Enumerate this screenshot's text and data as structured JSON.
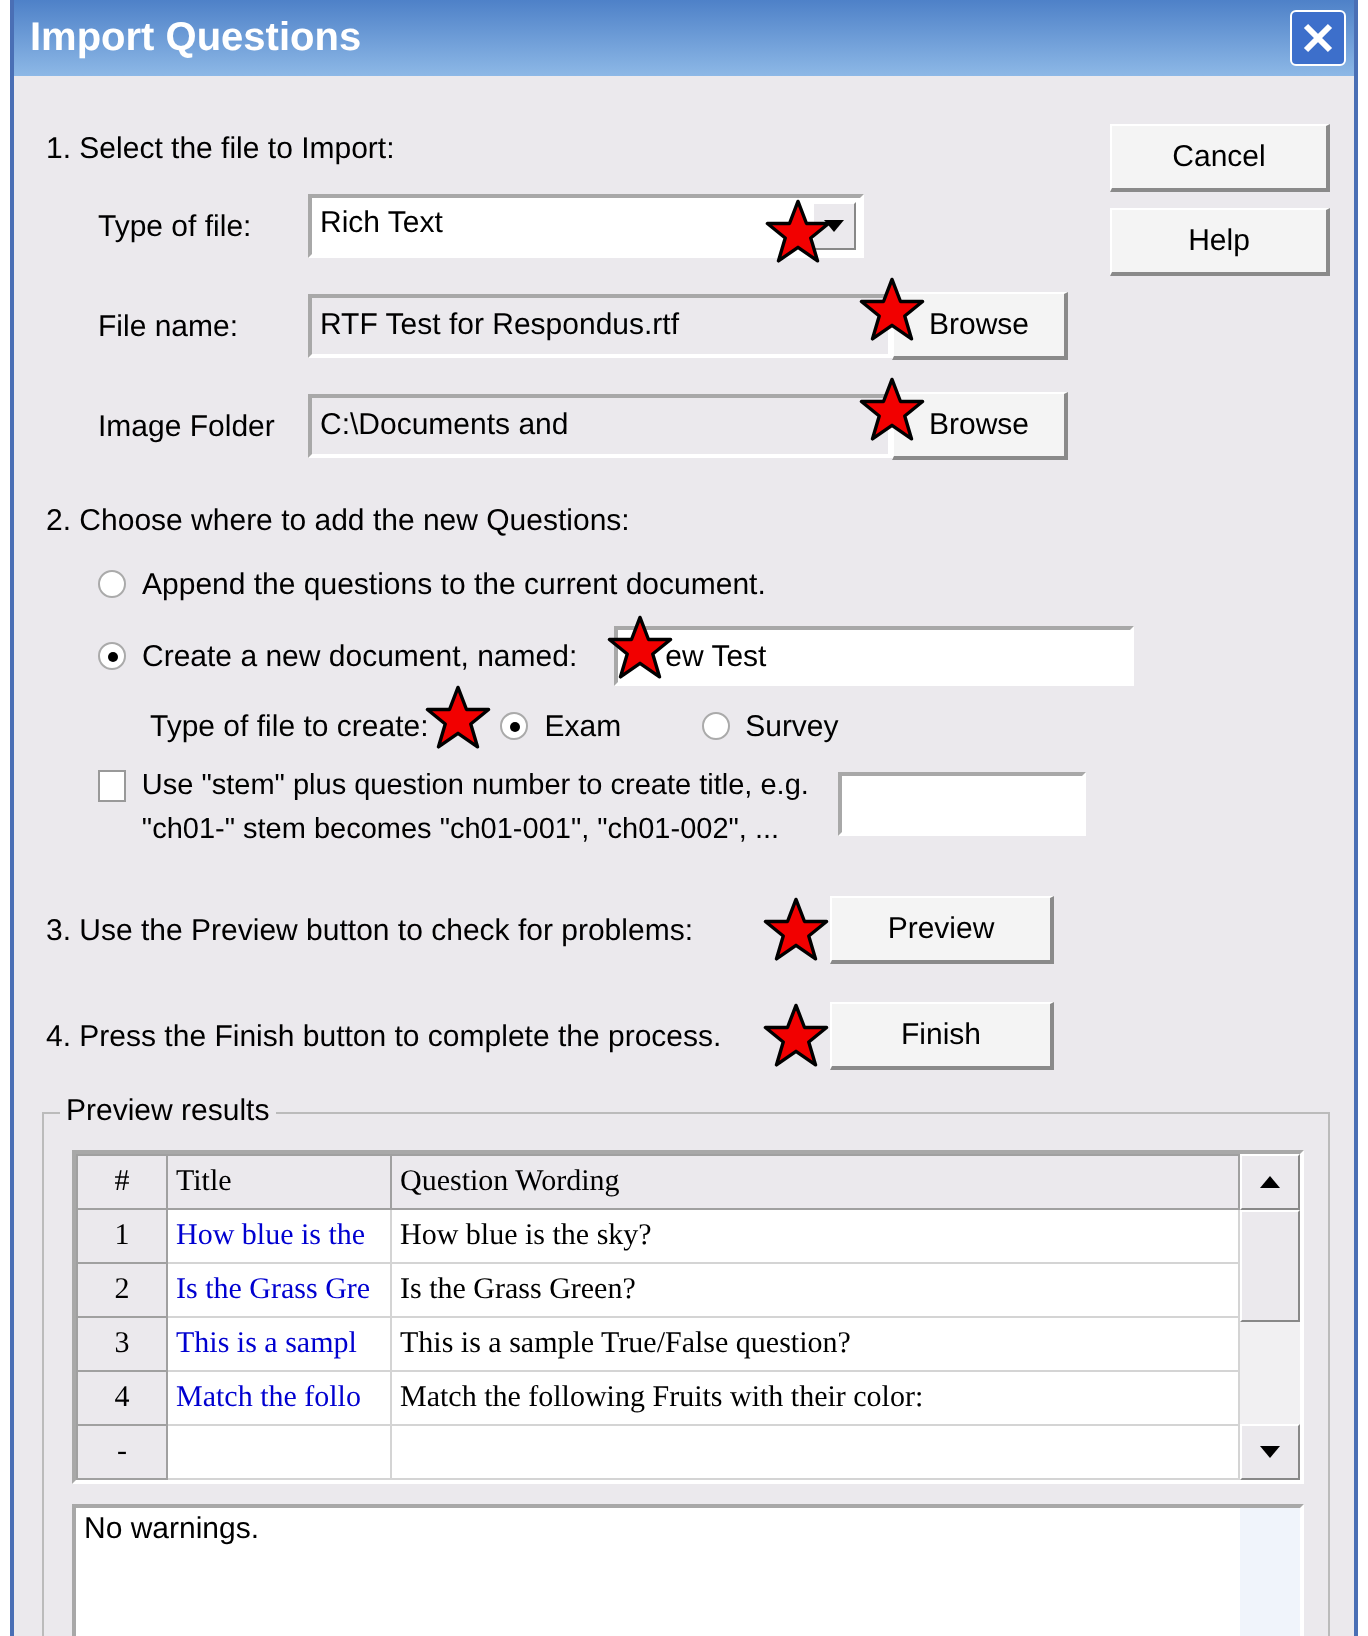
{
  "window": {
    "title": "Import Questions"
  },
  "side_buttons": [
    "Cancel",
    "Help"
  ],
  "step1": {
    "heading": "1.  Select the file to Import:",
    "type_of_file": {
      "label": "Type of file:",
      "value": "Rich Text"
    },
    "file_name": {
      "label": "File name:",
      "value": "RTF Test for Respondus.rtf",
      "button": "Browse"
    },
    "image_folder": {
      "label": "Image Folder",
      "value": "C:\\Documents and",
      "button": "Browse"
    }
  },
  "step2": {
    "heading": "2.  Choose where to add the new Questions:",
    "destinations": [
      {
        "label": "Append the questions to the current document.",
        "selected": false
      },
      {
        "label": "Create a new document, named:",
        "selected": true
      }
    ],
    "document_name": "ew Test",
    "type_label": "Type of file to create:",
    "types": [
      {
        "label": "Exam",
        "selected": true
      },
      {
        "label": "Survey",
        "selected": false
      }
    ],
    "stem": {
      "label_line1": "Use \"stem\" plus question number to create title,  e.g.",
      "label_line2": "\"ch01-\" stem becomes \"ch01-001\",  \"ch01-002\",  ...",
      "checked": false
    }
  },
  "step3": {
    "text": "3.  Use the Preview button to check for problems:",
    "button": "Preview"
  },
  "step4": {
    "text": "4.  Press the Finish button to complete the process.",
    "button": "Finish"
  },
  "preview": {
    "legend": "Preview results",
    "columns": [
      "#",
      "Title",
      "Question Wording"
    ],
    "rows": [
      {
        "num": "1",
        "title": "How blue is the",
        "wording": "How blue is the sky?"
      },
      {
        "num": "2",
        "title": "Is the Grass Gre",
        "wording": "Is the Grass Green?"
      },
      {
        "num": "3",
        "title": "This is a sampl",
        "wording": "This is a sample True/False question?"
      },
      {
        "num": "4",
        "title": "Match the follo",
        "wording": "Match the following Fruits with their color:"
      },
      {
        "num": "-",
        "title": "",
        "wording": ""
      }
    ],
    "warnings": "No warnings."
  }
}
